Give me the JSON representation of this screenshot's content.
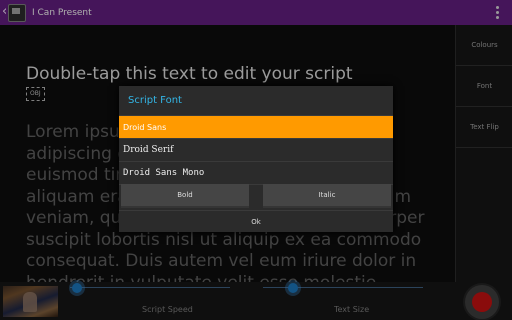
{
  "app": {
    "title": "I Can Present"
  },
  "main": {
    "headline": "Double-tap this text to edit your script",
    "obj_tag": "OBJ",
    "script_lines": [
      "Lorem ipsum dolor sit amet, consectetuer",
      "adipiscing elit, sed diam nonummy nibh",
      "euismod tincidunt ut laoreet dolore magna",
      "aliquam erat volutpat. Ut wisi enim ad minim",
      "veniam, quis nostrud exerci tation ullamcorper",
      "suscipit lobortis nisl ut aliquip ex ea commodo",
      "consequat. Duis autem vel eum iriure dolor in",
      "hendrerit in vulputate velit esse molestie"
    ]
  },
  "right_panel": {
    "items": [
      "Colours",
      "Font",
      "Text Flip"
    ]
  },
  "bottom": {
    "script_speed_label": "Script Speed",
    "text_size_label": "Text Size"
  },
  "dialog": {
    "title": "Script Font",
    "options": [
      "Droid Sans",
      "Droid Serif",
      "Droid Sans Mono"
    ],
    "selected": "Droid Sans",
    "bold_label": "Bold",
    "italic_label": "Italic",
    "ok_label": "Ok"
  },
  "colors": {
    "titlebar": "#5d1d78",
    "dialog_title": "#33b5e5",
    "selected_option": "#ff9a00",
    "record": "#b81010"
  }
}
